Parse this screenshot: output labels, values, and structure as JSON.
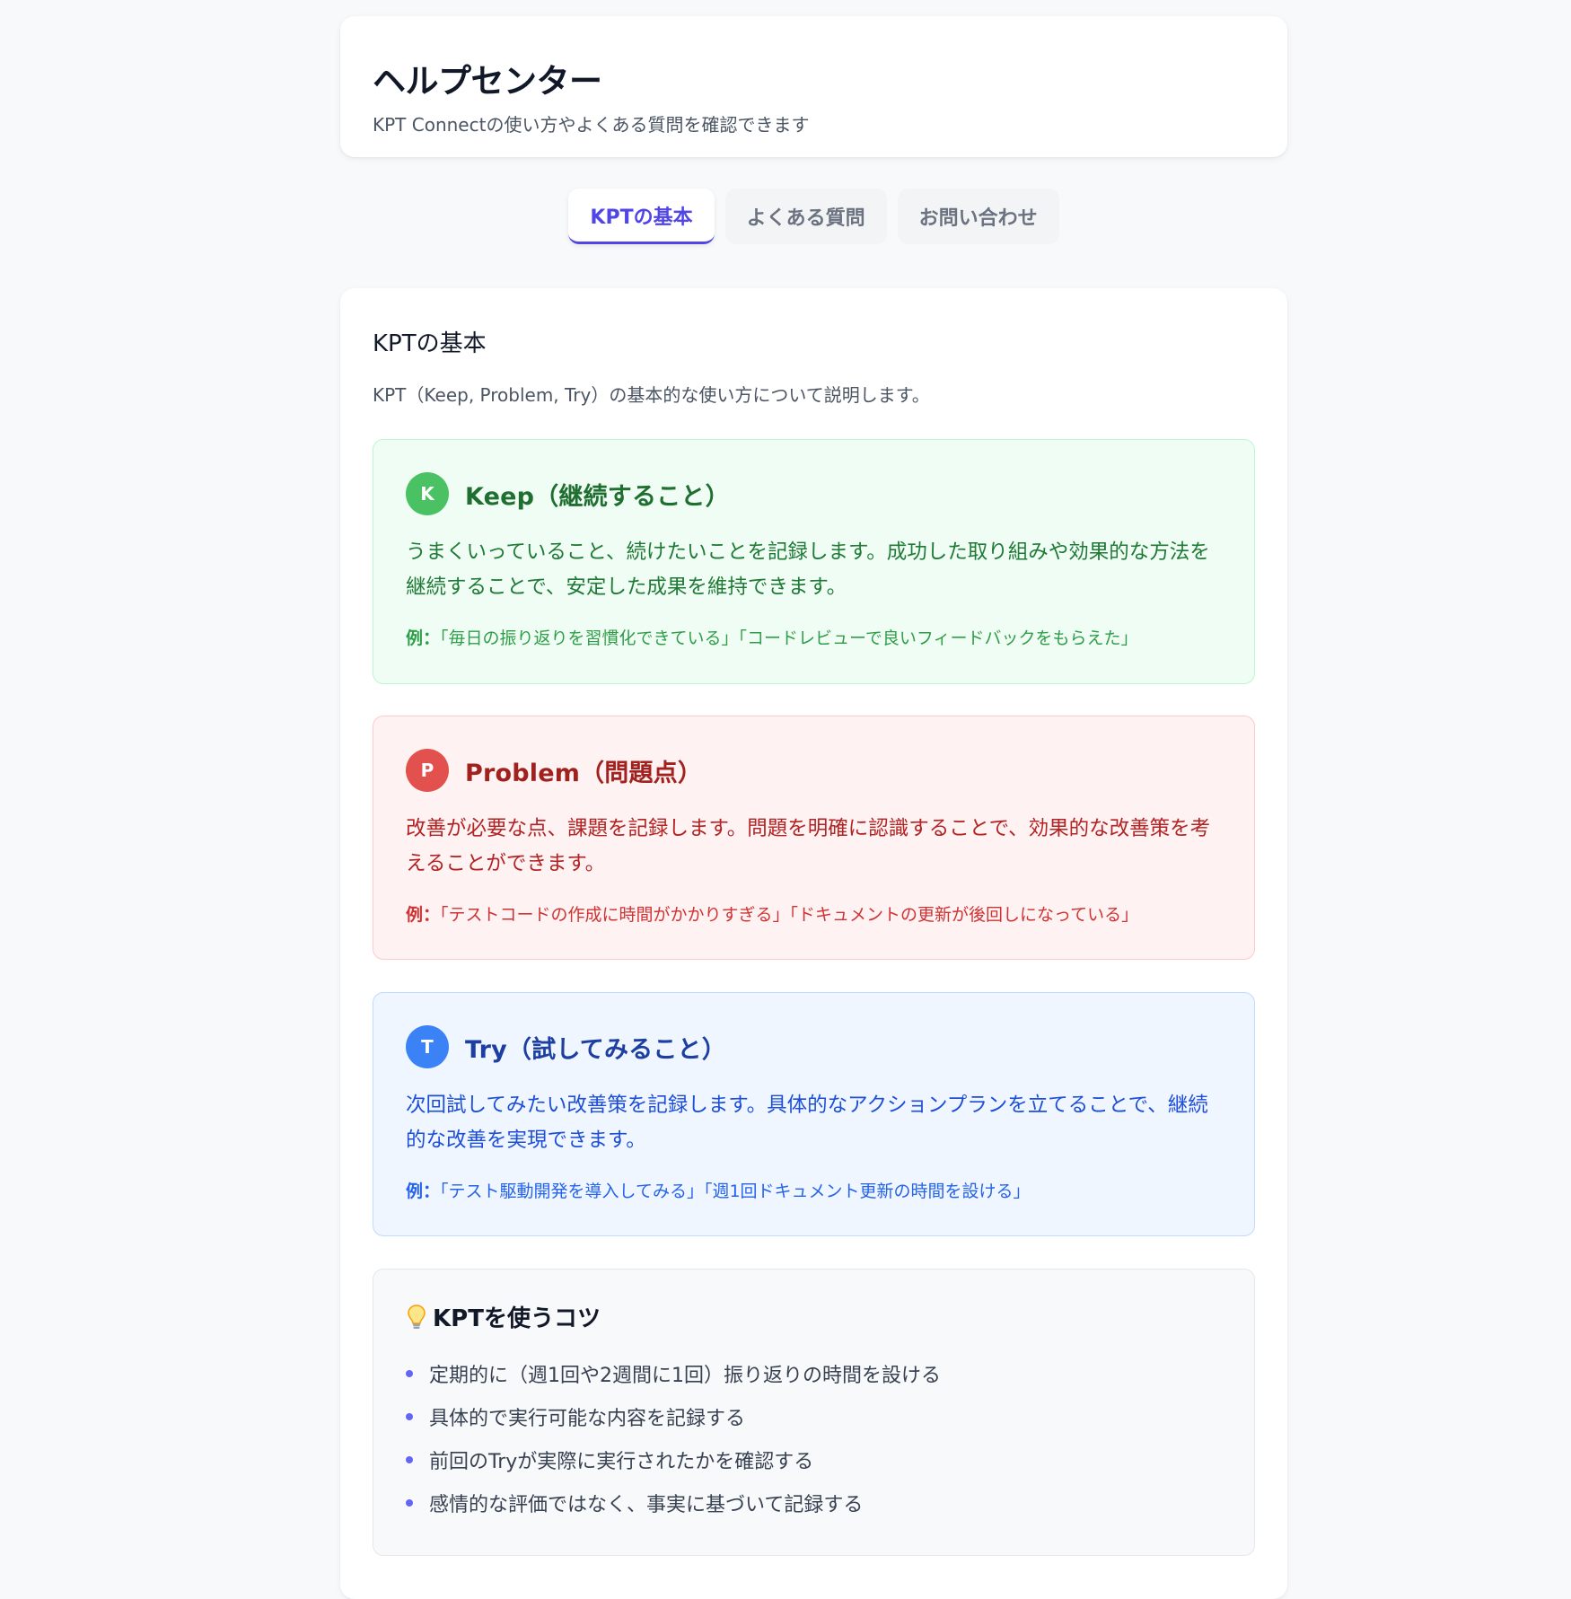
{
  "header": {
    "title": "ヘルプセンター",
    "subtitle": "KPT Connectの使い方やよくある質問を確認できます"
  },
  "tabs": [
    {
      "label": "KPTの基本",
      "active": true
    },
    {
      "label": "よくある質問",
      "active": false
    },
    {
      "label": "お問い合わせ",
      "active": false
    }
  ],
  "section": {
    "title": "KPTの基本",
    "description": "KPT（Keep, Problem, Try）の基本的な使い方について説明します。"
  },
  "kpt": {
    "keep": {
      "badge": "K",
      "title": "Keep（継続すること）",
      "description": "うまくいっていること、続けたいことを記録します。成功した取り組みや効果的な方法を継続することで、安定した成果を維持できます。",
      "example_label": "例：",
      "example_text": "「毎日の振り返りを習慣化できている」「コードレビューで良いフィードバックをもらえた」",
      "color": "#4ac163"
    },
    "problem": {
      "badge": "P",
      "title": "Problem（問題点）",
      "description": "改善が必要な点、課題を記録します。問題を明確に認識することで、効果的な改善策を考えることができます。",
      "example_label": "例：",
      "example_text": "「テストコードの作成に時間がかかりすぎる」「ドキュメントの更新が後回しになっている」",
      "color": "#e2514d"
    },
    "try": {
      "badge": "T",
      "title": "Try（試してみること）",
      "description": "次回試してみたい改善策を記録します。具体的なアクションプランを立てることで、継続的な改善を実現できます。",
      "example_label": "例：",
      "example_text": "「テスト駆動開発を導入してみる」「週1回ドキュメント更新の時間を設ける」",
      "color": "#3b82f6"
    }
  },
  "tips": {
    "icon": "lightbulb-icon",
    "title": "KPTを使うコツ",
    "items": [
      "定期的に（週1回や2週間に1回）振り返りの時間を設ける",
      "具体的で実行可能な内容を記録する",
      "前回のTryが実際に実行されたかを確認する",
      "感情的な評価ではなく、事実に基づいて記録する"
    ]
  },
  "colors": {
    "accent": "#4f46e5",
    "bullet": "#6366f1"
  }
}
